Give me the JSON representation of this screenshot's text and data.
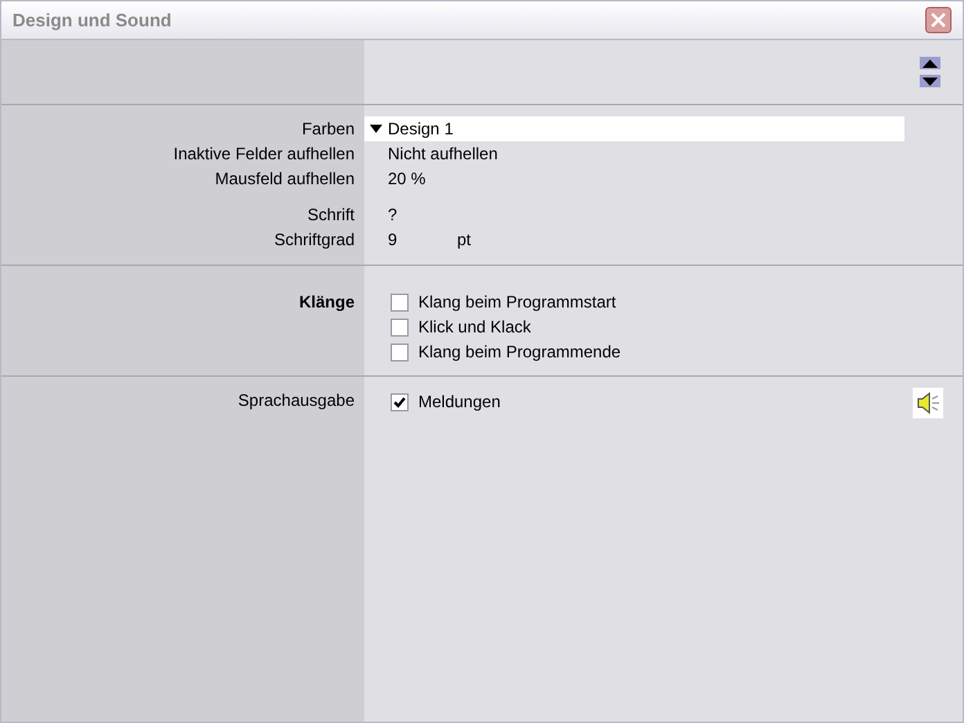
{
  "window": {
    "title": "Design und Sound"
  },
  "design": [
    {
      "kind": "dropdown",
      "label": "Farben",
      "value": "Design 1"
    },
    {
      "kind": "text",
      "label": "Inaktive Felder aufhellen",
      "value": "Nicht aufhellen"
    },
    {
      "kind": "text",
      "label": "Mausfeld aufhellen",
      "value": "20 %"
    },
    {
      "kind": "spacer"
    },
    {
      "kind": "text",
      "label": "Schrift",
      "value": "?"
    },
    {
      "kind": "unit",
      "label": "Schriftgrad",
      "value": "9",
      "unit": "pt"
    }
  ],
  "sounds": {
    "label": "Klänge",
    "options": [
      {
        "label": "Klang beim Programmstart",
        "checked": false
      },
      {
        "label": "Klick und Klack",
        "checked": false
      },
      {
        "label": "Klang beim Programmende",
        "checked": false
      }
    ]
  },
  "speech": {
    "label": "Sprachausgabe",
    "options": [
      {
        "label": "Meldungen",
        "checked": true
      }
    ]
  }
}
